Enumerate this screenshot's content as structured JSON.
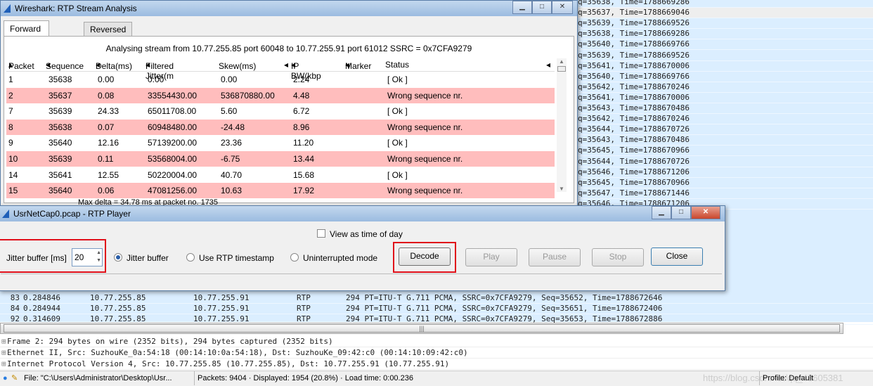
{
  "background_list": {
    "right_rows": [
      "q=35638, Time=1788669286",
      "q=35637, Time=1788669046",
      "q=35639, Time=1788669526",
      "q=35638, Time=1788669286",
      "q=35640, Time=1788669766",
      "q=35639, Time=1788669526",
      "q=35641, Time=1788670006",
      "q=35640, Time=1788669766",
      "q=35642, Time=1788670246",
      "q=35641, Time=1788670006",
      "q=35643, Time=1788670486",
      "q=35642, Time=1788670246",
      "q=35644, Time=1788670726",
      "q=35643, Time=1788670486",
      "q=35645, Time=1788670966",
      "q=35644, Time=1788670726",
      "q=35646, Time=1788671206",
      "q=35645, Time=1788670966",
      "q=35647, Time=1788671446",
      "q=35646, Time=1788671206"
    ],
    "bottom_rows": [
      {
        "no": "83",
        "time": "0.284846",
        "src": "10.77.255.85",
        "dst": "10.77.255.91",
        "proto": "RTP",
        "info": "294 PT=ITU-T G.711 PCMA, SSRC=0x7CFA9279, Seq=35652, Time=1788672646"
      },
      {
        "no": "84",
        "time": "0.284944",
        "src": "10.77.255.85",
        "dst": "10.77.255.91",
        "proto": "RTP",
        "info": "294 PT=ITU-T G.711 PCMA, SSRC=0x7CFA9279, Seq=35651, Time=1788672406"
      },
      {
        "no": "92",
        "time": "0.314609",
        "src": "10.77.255.85",
        "dst": "10.77.255.91",
        "proto": "RTP",
        "info": "294 PT=ITU-T G.711 PCMA, SSRC=0x7CFA9279, Seq=35653, Time=1788672886"
      }
    ]
  },
  "details": [
    "Frame 2: 294 bytes on wire (2352 bits), 294 bytes captured (2352 bits)",
    "Ethernet II, Src: SuzhouKe_0a:54:18 (00:14:10:0a:54:18), Dst: SuzhouKe_09:42:c0 (00:14:10:09:42:c0)",
    "Internet Protocol Version 4, Src: 10.77.255.85 (10.77.255.85), Dst: 10.77.255.91 (10.77.255.91)"
  ],
  "statusbar": {
    "file": "File: \"C:\\Users\\Administrator\\Desktop\\Usr...",
    "packets": "Packets: 9404 · Displayed: 1954 (20.8%) · Load time: 0:00.236",
    "profile": "Profile: Default",
    "watermark": "https://blog.csdn.net/qq_43605381"
  },
  "analysis": {
    "title": "Wireshark: RTP Stream Analysis",
    "tabs": [
      "Forward Direction",
      "Reversed Direction"
    ],
    "analysing": "Analysing stream from  10.77.255.85 port 60048  to  10.77.255.91 port 61012   SSRC = 0x7CFA9279",
    "columns": [
      "Packet",
      "Sequence",
      "Delta(ms)",
      "Filtered Jitter(m",
      "Skew(ms)",
      "IP BW(kbp",
      "Marker",
      "Status"
    ],
    "rows": [
      [
        "1",
        "35638",
        "0.00",
        "0.00",
        "0.00",
        "2.24",
        "",
        "[ Ok ]"
      ],
      [
        "2",
        "35637",
        "0.08",
        "33554430.00",
        "536870880.00",
        "4.48",
        "",
        "Wrong sequence nr."
      ],
      [
        "7",
        "35639",
        "24.33",
        "65011708.00",
        "5.60",
        "6.72",
        "",
        "[ Ok ]"
      ],
      [
        "8",
        "35638",
        "0.07",
        "60948480.00",
        "-24.48",
        "8.96",
        "",
        "Wrong sequence nr."
      ],
      [
        "9",
        "35640",
        "12.16",
        "57139200.00",
        "23.36",
        "11.20",
        "",
        "[ Ok ]"
      ],
      [
        "10",
        "35639",
        "0.11",
        "53568004.00",
        "-6.75",
        "13.44",
        "",
        "Wrong sequence nr."
      ],
      [
        "14",
        "35641",
        "12.55",
        "50220004.00",
        "40.70",
        "15.68",
        "",
        "[ Ok ]"
      ],
      [
        "15",
        "35640",
        "0.06",
        "47081256.00",
        "10.63",
        "17.92",
        "",
        "Wrong sequence nr."
      ]
    ],
    "max_delta": "Max delta = 34.78 ms at packet no. 1735",
    "error_row_color": "#ffbdbd"
  },
  "player": {
    "title": "UsrNetCap0.pcap - RTP Player",
    "view_time_of_day": "View as time of day",
    "jitter_label": "Jitter buffer [ms]",
    "jitter_value": "20",
    "radios": [
      {
        "label": "Jitter buffer",
        "checked": true
      },
      {
        "label": "Use RTP timestamp",
        "checked": false
      },
      {
        "label": "Uninterrupted mode",
        "checked": false
      }
    ],
    "buttons": {
      "decode": "Decode",
      "play": "Play",
      "pause": "Pause",
      "stop": "Stop",
      "close": "Close"
    },
    "highlight_color": "#e0101a"
  }
}
